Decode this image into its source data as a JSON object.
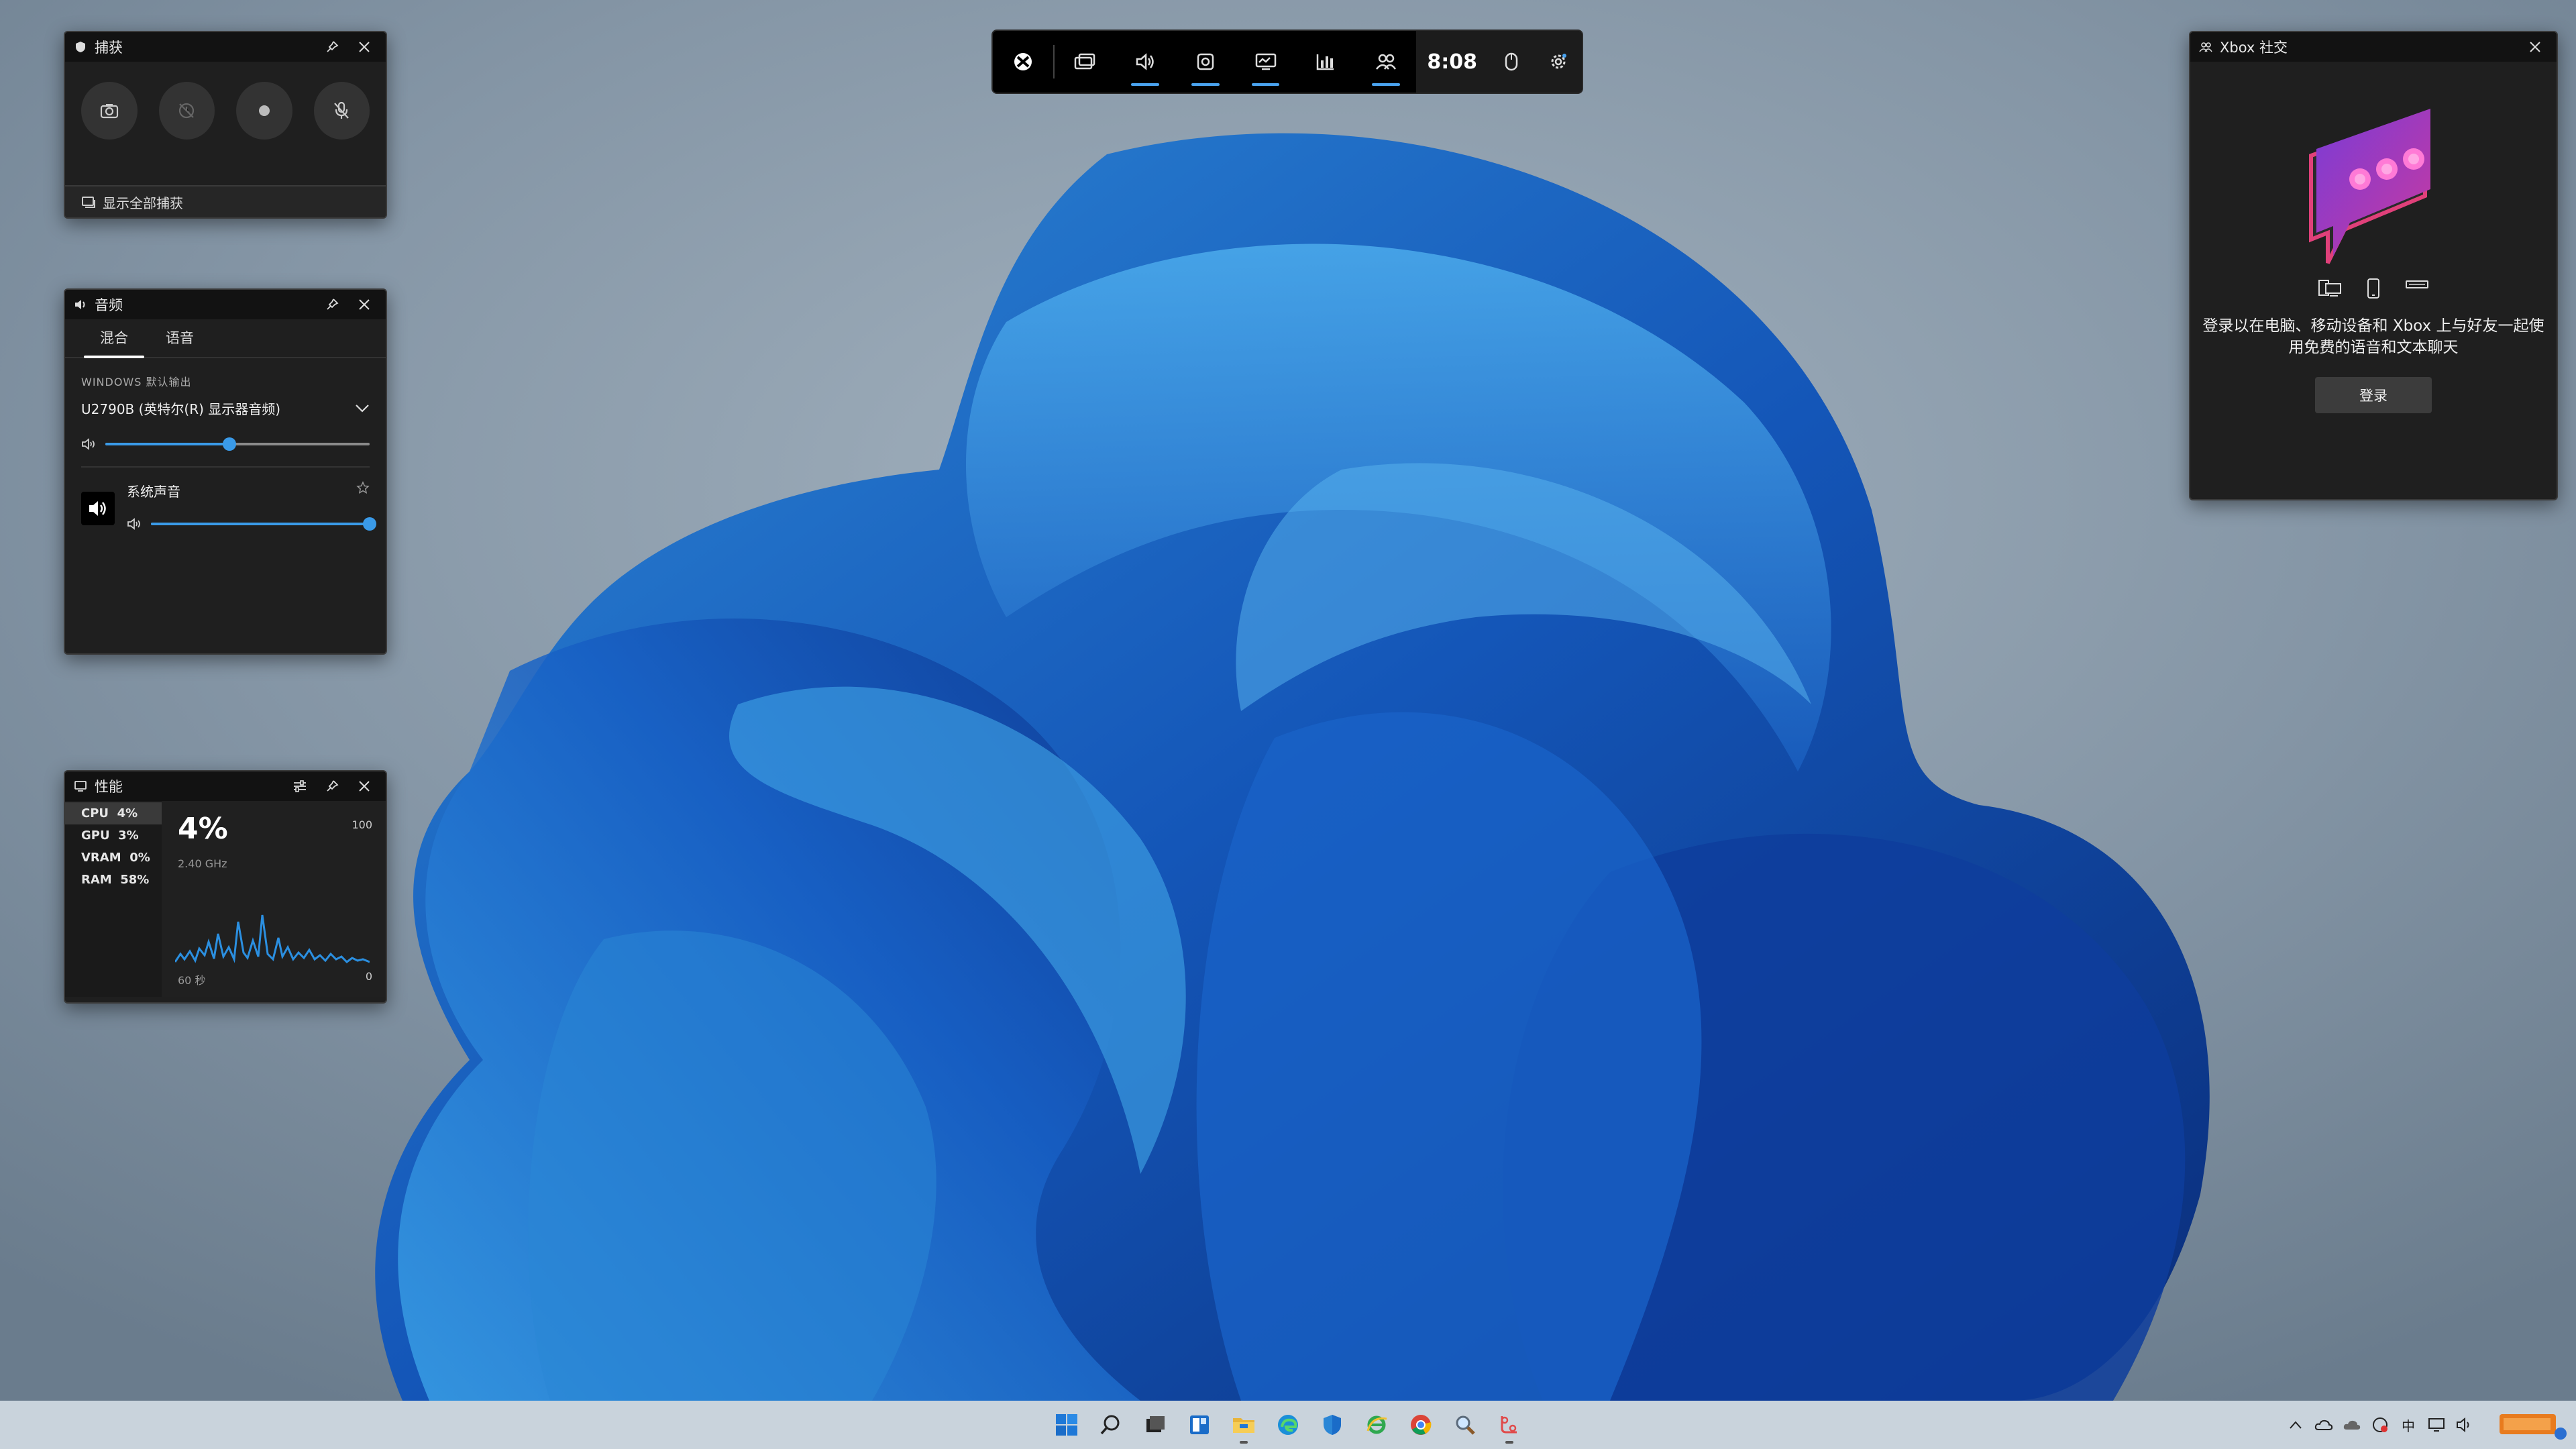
{
  "game_bar": {
    "clock": "8:08",
    "buttons": [
      "xbox-logo-icon",
      "widget-menu-icon",
      "audio-icon",
      "capture-icon",
      "performance-icon",
      "resources-icon",
      "xbox-social-icon"
    ],
    "active": [
      "audio",
      "capture",
      "performance",
      "xbox-social"
    ]
  },
  "capture": {
    "title": "捕获",
    "footer": "显示全部捕获"
  },
  "audio": {
    "title": "音频",
    "tabs": [
      "混合",
      "语音"
    ],
    "default_output_label": "WINDOWS 默认输出",
    "device": "U2790B (英特尔(R) 显示器音频)",
    "device_volume": 0.47,
    "app_name": "系统声音",
    "app_volume": 1.0
  },
  "performance": {
    "title": "性能",
    "items": [
      {
        "label": "CPU",
        "value": "4%"
      },
      {
        "label": "GPU",
        "value": "3%"
      },
      {
        "label": "VRAM",
        "value": "0%"
      },
      {
        "label": "RAM",
        "value": "58%"
      }
    ],
    "big_value": "4%",
    "clock_speed": "2.40 GHz",
    "scale_max": "100",
    "scale_min": "0",
    "time_window": "60 秒"
  },
  "social": {
    "title": "Xbox 社交",
    "message": "登录以在电脑、移动设备和 Xbox 上与好友一起使用免费的语音和文本聊天",
    "login": "登录"
  },
  "taskbar": {
    "ime": "中"
  },
  "colors": {
    "accent": "#3a9ae8",
    "panel_bg": "#1f1f1f",
    "taskbar_bg": "#c9d3dc"
  }
}
